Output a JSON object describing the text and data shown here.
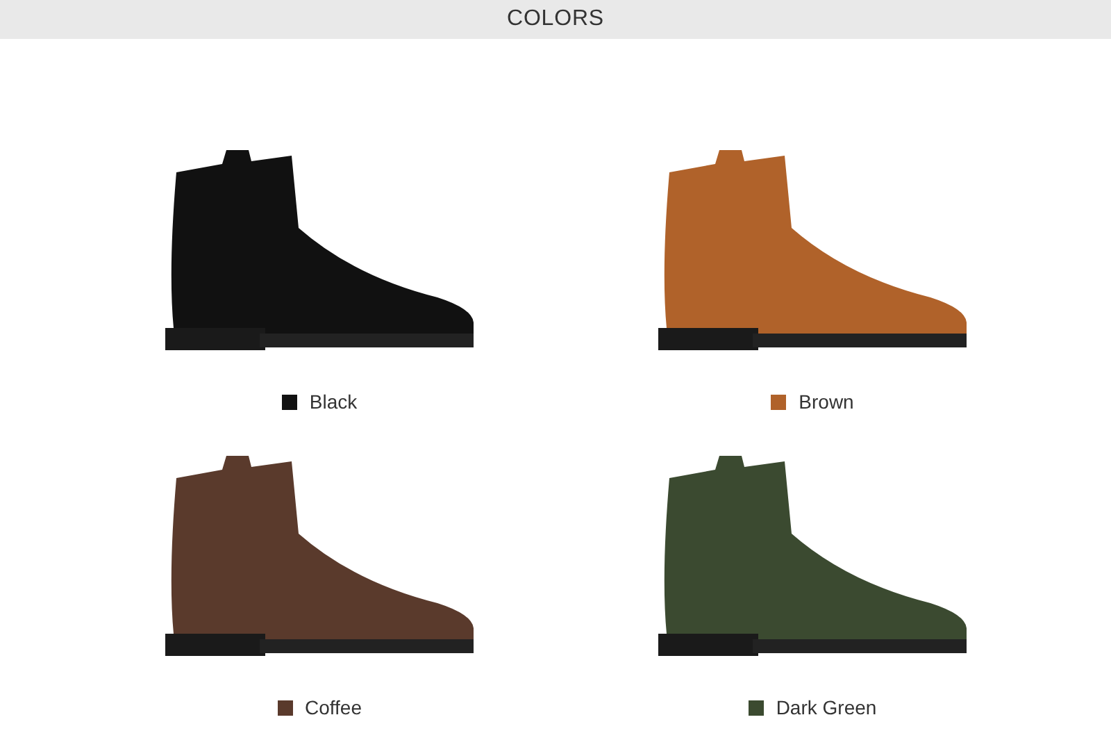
{
  "header": {
    "title": "COLORS"
  },
  "colors": [
    {
      "label": "Black",
      "color": "#111111"
    },
    {
      "label": "Brown",
      "color": "#b0622a"
    },
    {
      "label": "Coffee",
      "color": "#5a3a2c"
    },
    {
      "label": "Dark Green",
      "color": "#3b4a30"
    }
  ]
}
